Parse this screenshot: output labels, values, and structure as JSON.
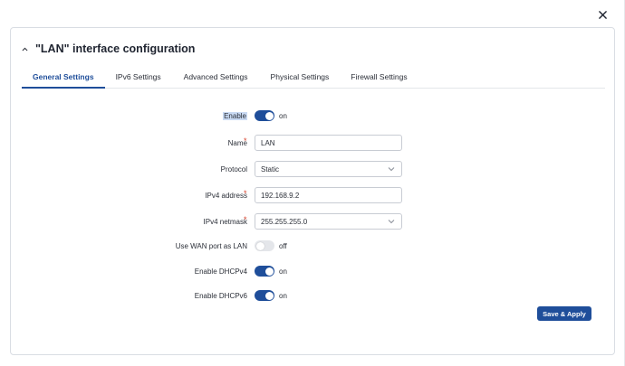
{
  "dialog": {
    "title": "\"LAN\" interface configuration",
    "save_label": "Save & Apply"
  },
  "tabs": [
    {
      "label": "General Settings",
      "active": true
    },
    {
      "label": "IPv6 Settings",
      "active": false
    },
    {
      "label": "Advanced Settings",
      "active": false
    },
    {
      "label": "Physical Settings",
      "active": false
    },
    {
      "label": "Firewall Settings",
      "active": false
    }
  ],
  "fields": {
    "enable": {
      "label": "Enable",
      "state": "on",
      "checked": true
    },
    "name": {
      "label": "Name",
      "value": "LAN",
      "required": true
    },
    "protocol": {
      "label": "Protocol",
      "value": "Static"
    },
    "ipv4_address": {
      "label": "IPv4 address",
      "value": "192.168.9.2",
      "required": true
    },
    "ipv4_netmask": {
      "label": "IPv4 netmask",
      "value": "255.255.255.0",
      "required": true
    },
    "use_wan_port": {
      "label": "Use WAN port as LAN",
      "state": "off",
      "checked": false
    },
    "dhcpv4": {
      "label": "Enable DHCPv4",
      "state": "on",
      "checked": true
    },
    "dhcpv6": {
      "label": "Enable DHCPv6",
      "state": "on",
      "checked": true
    }
  },
  "required_mark": "*",
  "colors": {
    "accent": "#1f4e9a",
    "required": "#d9432e",
    "border": "#c8ccd3"
  },
  "icons": {
    "close": "close-icon",
    "collapse": "chevron-up-icon",
    "dropdown": "chevron-down-icon"
  }
}
